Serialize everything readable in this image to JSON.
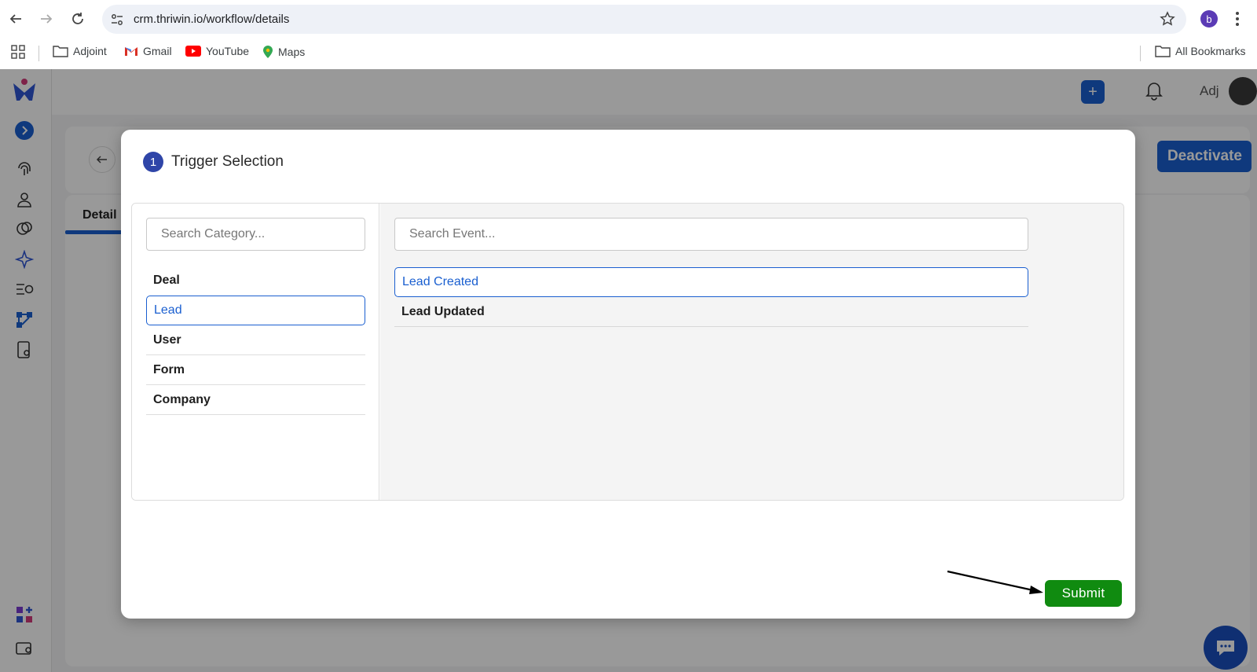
{
  "browser": {
    "url": "crm.thriwin.io/workflow/details",
    "profile_initial": "b",
    "bookmarks": [
      "Adjoint",
      "Gmail",
      "YouTube",
      "Maps"
    ],
    "all_bookmarks": "All Bookmarks"
  },
  "app": {
    "user_name": "Adj",
    "deactivate_label": "Deactivate",
    "detail_tab": "Detail",
    "accent_color": "#1a5fd0"
  },
  "modal": {
    "step_number": "1",
    "title": "Trigger Selection",
    "category_search_placeholder": "Search Category...",
    "event_search_placeholder": "Search Event...",
    "categories": [
      "Deal",
      "Lead",
      "User",
      "Form",
      "Company"
    ],
    "selected_category": "Lead",
    "events": [
      "Lead Created",
      "Lead Updated"
    ],
    "selected_event": "Lead Created",
    "submit_label": "Submit",
    "submit_color": "#108b10"
  }
}
